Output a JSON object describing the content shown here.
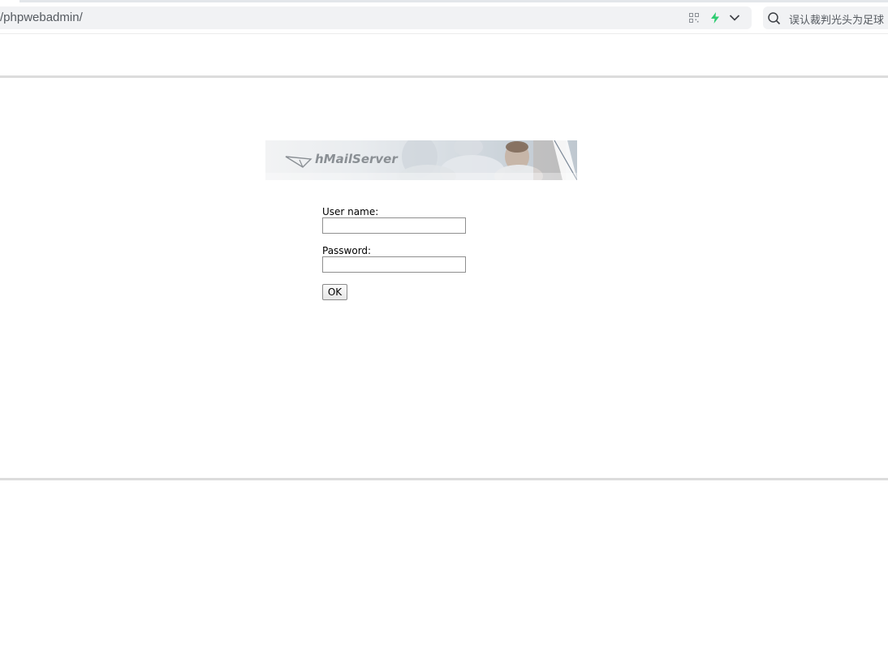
{
  "browser": {
    "address": "/phpwebadmin/",
    "search_text": "误认裁判光头为足球",
    "icons": {
      "qr": "qr-code-icon",
      "bolt": "lightning-icon",
      "chevron": "chevron-down-icon",
      "search": "search-icon"
    },
    "accent_color": "#2ecc71"
  },
  "banner": {
    "logo_text": "hMailServer",
    "logo_icon": "paper-plane-icon"
  },
  "login_form": {
    "username_label": "User name:",
    "username_value": "",
    "password_label": "Password:",
    "password_value": "",
    "submit_label": "OK"
  }
}
